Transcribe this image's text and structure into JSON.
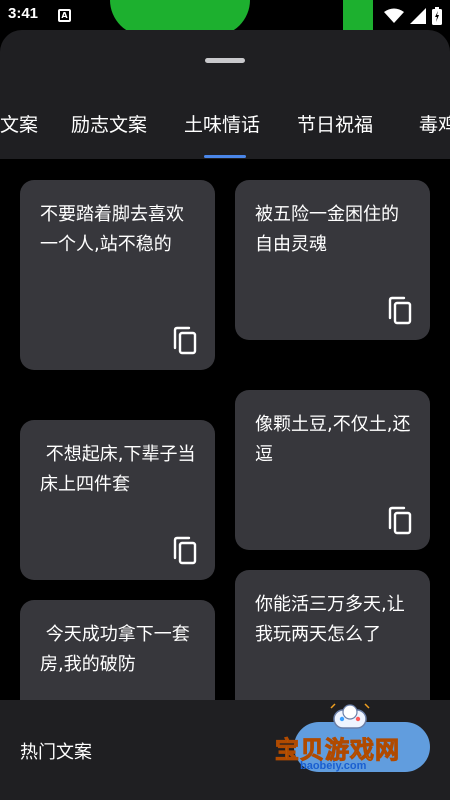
{
  "status": {
    "time": "3:41",
    "notif_icon": "A",
    "icons": [
      "wifi-icon",
      "signal-icon",
      "battery-icon"
    ]
  },
  "tabs": [
    {
      "label": "文案"
    },
    {
      "label": "励志文案"
    },
    {
      "label": "土味情话"
    },
    {
      "label": "节日祝福"
    },
    {
      "label": "毒鸡"
    }
  ],
  "selected_tab": "土味情话",
  "cards": [
    {
      "text": "不要踏着脚去喜欢一个人,站不稳的"
    },
    {
      "text": "被五险一金困住的自由灵魂"
    },
    {
      "text": " 不想起床,下辈子当床上四件套"
    },
    {
      "text": "像颗土豆,不仅土,还逗"
    },
    {
      "text": " 今天成功拿下一套房,我的破防"
    },
    {
      "text": "你能活三万多天,让我玩两天怎么了"
    }
  ],
  "bottom": {
    "label": "热门文案"
  },
  "watermark": {
    "text": "宝贝游戏网",
    "url": "baobeiy.com"
  },
  "colors": {
    "sheet": "#1f1f22",
    "card": "#37373c",
    "accent": "#4a86e8",
    "status_green": "#1db02f"
  }
}
